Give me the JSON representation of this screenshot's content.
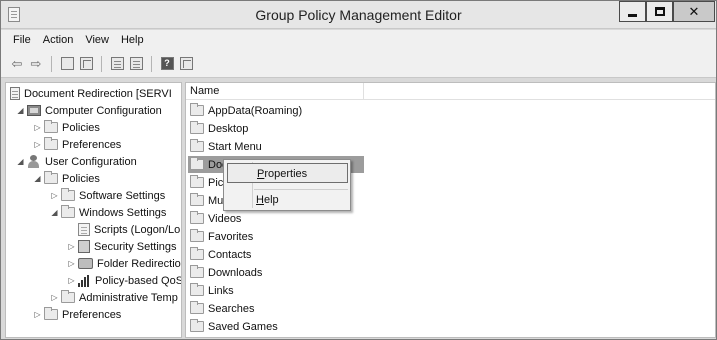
{
  "window": {
    "title": "Group Policy Management Editor"
  },
  "menubar": {
    "items": [
      "File",
      "Action",
      "View",
      "Help"
    ]
  },
  "toolbar": {
    "icons": [
      "back-arrow-icon",
      "forward-arrow-icon",
      "up-folder-icon",
      "show-hide-tree-icon",
      "export-list-icon",
      "properties-icon",
      "help-icon",
      "view-pane-icon"
    ]
  },
  "tree": {
    "root": "Document Redirection [SERVI",
    "items": [
      "Computer Configuration",
      "Policies",
      "Preferences",
      "User Configuration",
      "Policies",
      "Software Settings",
      "Windows Settings",
      "Scripts (Logon/Lo",
      "Security Settings",
      "Folder Redirectio",
      "Policy-based QoS",
      "Administrative Temp",
      "Preferences"
    ]
  },
  "list": {
    "column_name": "Name",
    "rows": [
      "AppData(Roaming)",
      "Desktop",
      "Start Menu",
      "Doc",
      "Pict",
      "Mu",
      "Videos",
      "Favorites",
      "Contacts",
      "Downloads",
      "Links",
      "Searches",
      "Saved Games"
    ]
  },
  "context_menu": {
    "items": [
      "Properties",
      "Help"
    ]
  }
}
